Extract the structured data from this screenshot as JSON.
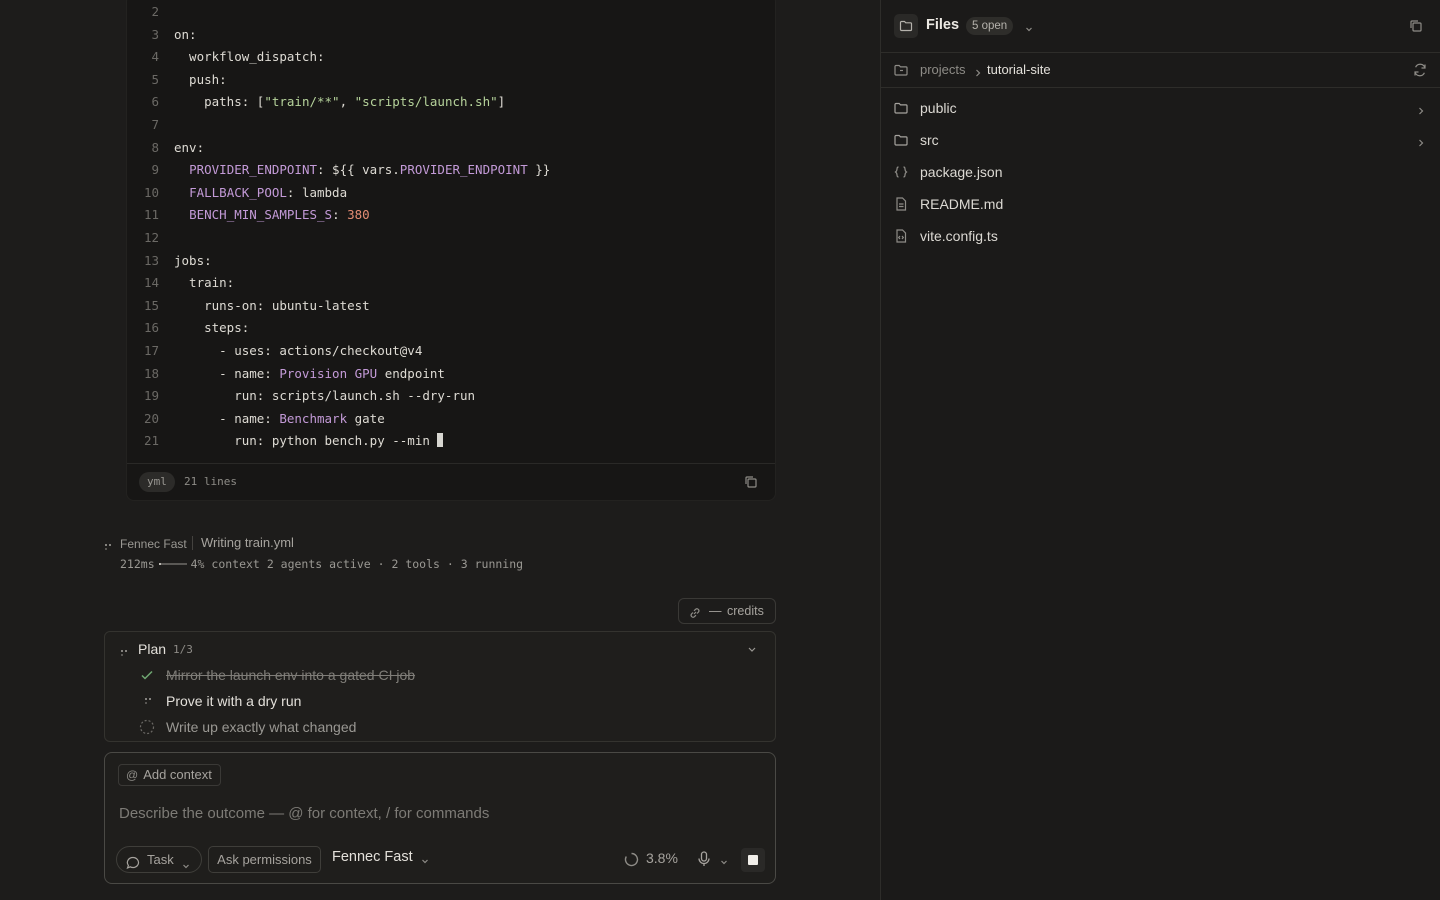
{
  "code_block": {
    "language": "yml",
    "line_count_label": "21 lines",
    "lines": [
      {
        "n": "2",
        "segs": []
      },
      {
        "n": "3",
        "segs": [
          {
            "t": "on:",
            "c": "key"
          }
        ]
      },
      {
        "n": "4",
        "segs": [
          {
            "t": "  workflow_dispatch:",
            "c": "key"
          }
        ]
      },
      {
        "n": "5",
        "segs": [
          {
            "t": "  push:",
            "c": "key"
          }
        ]
      },
      {
        "n": "6",
        "segs": [
          {
            "t": "    paths: [",
            "c": "key"
          },
          {
            "t": "\"train/**\"",
            "c": "str"
          },
          {
            "t": ", ",
            "c": "key"
          },
          {
            "t": "\"scripts/launch.sh\"",
            "c": "str"
          },
          {
            "t": "]",
            "c": "key"
          }
        ]
      },
      {
        "n": "7",
        "segs": []
      },
      {
        "n": "8",
        "segs": [
          {
            "t": "env:",
            "c": "key"
          }
        ]
      },
      {
        "n": "9",
        "segs": [
          {
            "t": "  ",
            "c": "key"
          },
          {
            "t": "PROVIDER_ENDPOINT",
            "c": "var"
          },
          {
            "t": ": ${{ vars.",
            "c": "key"
          },
          {
            "t": "PROVIDER_ENDPOINT",
            "c": "var"
          },
          {
            "t": " }}",
            "c": "key"
          }
        ]
      },
      {
        "n": "10",
        "segs": [
          {
            "t": "  ",
            "c": "key"
          },
          {
            "t": "FALLBACK_POOL",
            "c": "var"
          },
          {
            "t": ": lambda",
            "c": "key"
          }
        ]
      },
      {
        "n": "11",
        "segs": [
          {
            "t": "  ",
            "c": "key"
          },
          {
            "t": "BENCH_MIN_SAMPLES_S",
            "c": "var"
          },
          {
            "t": ": ",
            "c": "key"
          },
          {
            "t": "380",
            "c": "num"
          }
        ]
      },
      {
        "n": "12",
        "segs": []
      },
      {
        "n": "13",
        "segs": [
          {
            "t": "jobs:",
            "c": "key"
          }
        ]
      },
      {
        "n": "14",
        "segs": [
          {
            "t": "  train:",
            "c": "key"
          }
        ]
      },
      {
        "n": "15",
        "segs": [
          {
            "t": "    runs-on: ubuntu-latest",
            "c": "key"
          }
        ]
      },
      {
        "n": "16",
        "segs": [
          {
            "t": "    steps:",
            "c": "key"
          }
        ]
      },
      {
        "n": "17",
        "segs": [
          {
            "t": "      - uses: actions/checkout@v4",
            "c": "key"
          }
        ]
      },
      {
        "n": "18",
        "segs": [
          {
            "t": "      - name: ",
            "c": "key"
          },
          {
            "t": "Provision GPU",
            "c": "var"
          },
          {
            "t": " endpoint",
            "c": "key"
          }
        ]
      },
      {
        "n": "19",
        "segs": [
          {
            "t": "        run: scripts/launch.sh --dry-run",
            "c": "key"
          }
        ]
      },
      {
        "n": "20",
        "segs": [
          {
            "t": "      - name: ",
            "c": "key"
          },
          {
            "t": "Benchmark",
            "c": "var"
          },
          {
            "t": " gate",
            "c": "key"
          }
        ]
      },
      {
        "n": "21",
        "segs": [
          {
            "t": "        run: python bench.py --min ",
            "c": "key"
          }
        ],
        "cursor": true
      }
    ]
  },
  "status": {
    "agent": "Fennec Fast",
    "message": "Writing train.yml",
    "latency": "212ms",
    "context_fraction": 0.04,
    "context_label": "4% context",
    "agents": "2 agents active",
    "tools": "2 tools",
    "running": "3 running",
    "separator": "·"
  },
  "credits": {
    "dash": "—",
    "label": "credits"
  },
  "plan": {
    "title": "Plan",
    "progress": "1/3",
    "items": [
      {
        "label": "Mirror the launch env into a gated CI job",
        "state": "done"
      },
      {
        "label": "Prove it with a dry run",
        "state": "active"
      },
      {
        "label": "Write up exactly what changed",
        "state": "todo"
      }
    ]
  },
  "composer": {
    "add_context_at": "@",
    "add_context_label": "Add context",
    "placeholder": "Describe the outcome — @ for context, / for commands",
    "mode_label": "Task",
    "permissions_label": "Ask permissions",
    "model_label": "Fennec Fast",
    "usage_label": "3.8%"
  },
  "files_panel": {
    "title": "Files",
    "open_badge": "5 open",
    "breadcrumb_root": "projects",
    "breadcrumb_current": "tutorial-site",
    "entries": [
      {
        "name": "public",
        "type": "folder"
      },
      {
        "name": "src",
        "type": "folder"
      },
      {
        "name": "package.json",
        "type": "json"
      },
      {
        "name": "README.md",
        "type": "doc"
      },
      {
        "name": "vite.config.ts",
        "type": "code"
      }
    ]
  },
  "colors": {
    "background": "#1d1c1b",
    "panel": "#1b1a19",
    "code_var": "#c39ad7",
    "code_string": "#b6d39b",
    "code_number": "#e58c74",
    "done_check": "#6fa772"
  }
}
